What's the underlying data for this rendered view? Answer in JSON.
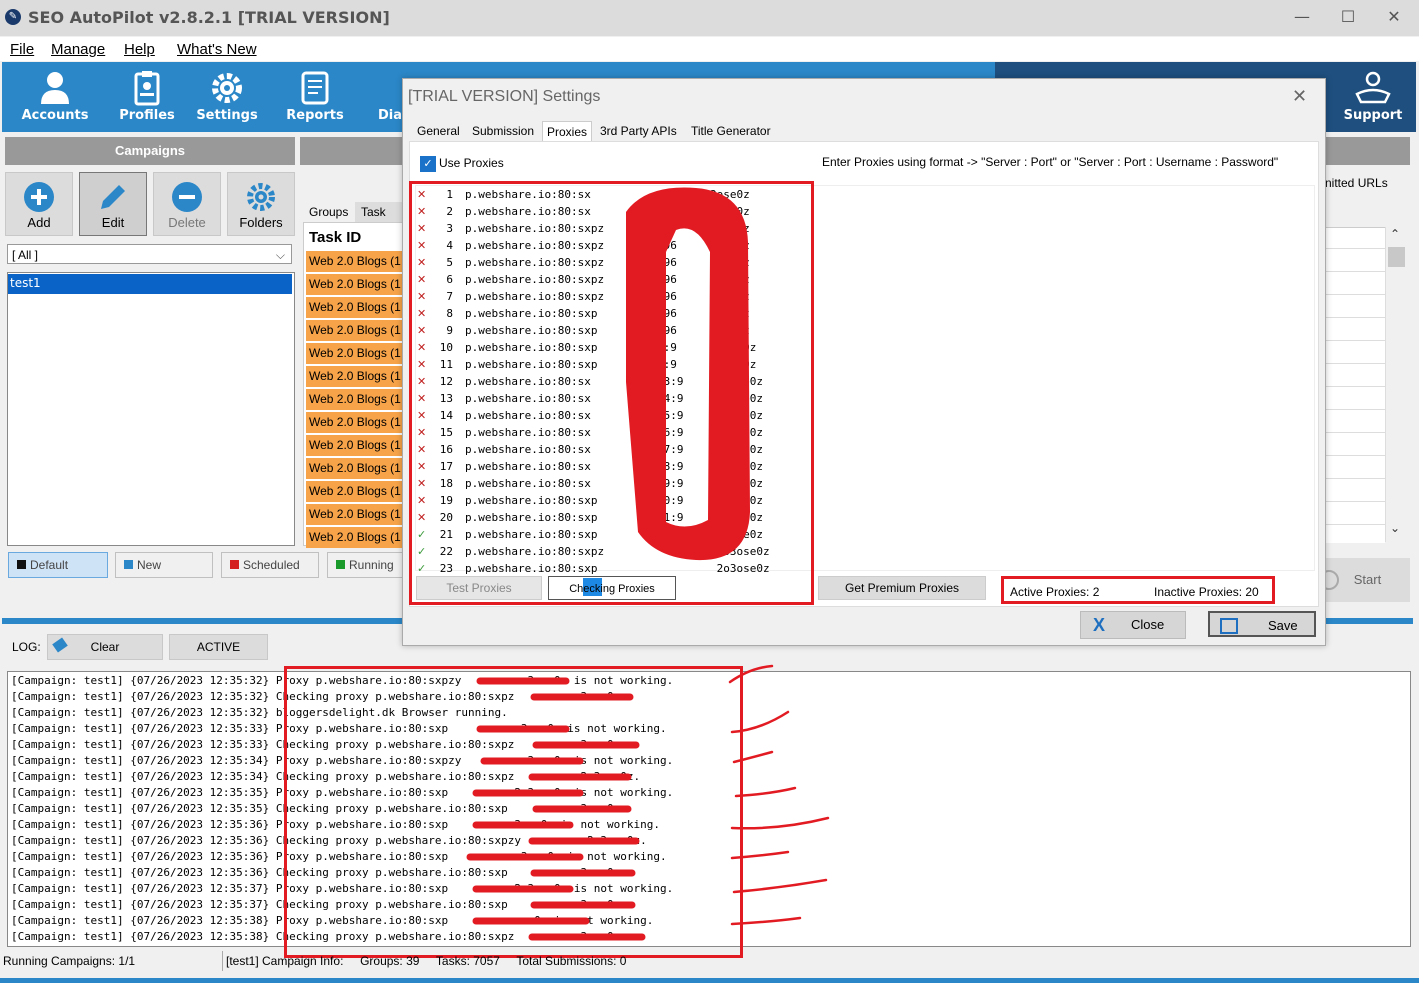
{
  "window": {
    "title": "SEO AutoPilot v2.8.2.1  [TRIAL VERSION]",
    "minimize": "—",
    "maximize": "☐",
    "close": "✕"
  },
  "menu": {
    "file": "File",
    "manage": "Manage",
    "help": "Help",
    "whats_new": "What's New"
  },
  "toolbar": {
    "accounts": "Accounts",
    "profiles": "Profiles",
    "settings": "Settings",
    "reports": "Reports",
    "diag": "Diag",
    "support": "Support"
  },
  "campaigns": {
    "header": "Campaigns",
    "add": "Add",
    "edit": "Edit",
    "delete": "Delete",
    "folders": "Folders",
    "filter": "[ All ]",
    "items": [
      "test1"
    ]
  },
  "status_tabs": {
    "default": "Default",
    "new": "New",
    "scheduled": "Scheduled",
    "running": "Running"
  },
  "groups": {
    "tab_groups": "Groups",
    "tab_task": "Task De",
    "task_id_header": "Task ID",
    "rows": [
      "Web 2.0 Blogs (1",
      "Web 2.0 Blogs (1",
      "Web 2.0 Blogs (1",
      "Web 2.0 Blogs (1",
      "Web 2.0 Blogs (1",
      "Web 2.0 Blogs (1",
      "Web 2.0 Blogs (1",
      "Web 2.0 Blogs (1",
      "Web 2.0 Blogs (1",
      "Web 2.0 Blogs (1",
      "Web 2.0 Blogs (1",
      "Web 2.0 Blogs (1",
      "Web 2.0 Blogs (1"
    ]
  },
  "right_panel": {
    "urls_label": "nitted URLs",
    "start": "Start"
  },
  "log": {
    "label": "LOG:",
    "clear": "Clear",
    "active": "ACTIVE",
    "lines": [
      "[Campaign: test1] {07/26/2023 12:35:32} Proxy p.webshare.io:80:sxpzy          3ose0z is not working.",
      "[Campaign: test1] {07/26/2023 12:35:32} Checking proxy p.webshare.io:80:sxpz          3ose0z.",
      "[Campaign: test1] {07/26/2023 12:35:32} bloggersdelight.dk Browser running.",
      "[Campaign: test1] {07/26/2023 12:35:33} Proxy p.webshare.io:80:sxp          o3ose0z is not working.",
      "[Campaign: test1] {07/26/2023 12:35:33} Checking proxy p.webshare.io:80:sxpz          3ose0z.",
      "[Campaign: test1] {07/26/2023 12:35:34} Proxy p.webshare.io:80:sxpzy          3ose0z is not working.",
      "[Campaign: test1] {07/26/2023 12:35:34} Checking proxy p.webshare.io:80:sxpz          2o3ose0z.",
      "[Campaign: test1] {07/26/2023 12:35:35} Proxy p.webshare.io:80:sxp          2o3ose0z is not working.",
      "[Campaign: test1] {07/26/2023 12:35:35} Checking proxy p.webshare.io:80:sxp          o3ose0z.",
      "[Campaign: test1] {07/26/2023 12:35:36} Proxy p.webshare.io:80:sxp          3ose0z is not working.",
      "[Campaign: test1] {07/26/2023 12:35:36} Checking proxy p.webshare.io:80:sxpzy          2o3ose0z.",
      "[Campaign: test1] {07/26/2023 12:35:36} Proxy p.webshare.io:80:sxp          o3ose0z is not working.",
      "[Campaign: test1] {07/26/2023 12:35:36} Checking proxy p.webshare.io:80:sxp          o3ose0z.",
      "[Campaign: test1] {07/26/2023 12:35:37} Proxy p.webshare.io:80:sxp          2o3ose0z is not working.",
      "[Campaign: test1] {07/26/2023 12:35:37} Checking proxy p.webshare.io:80:sxp          o3ose0z.",
      "[Campaign: test1] {07/26/2023 12:35:38} Proxy p.webshare.io:80:sxp          ose0z is not working.",
      "[Campaign: test1] {07/26/2023 12:35:38} Checking proxy p.webshare.io:80:sxpz          3ose0z."
    ]
  },
  "status_bar": {
    "running": "Running Campaigns: 1/1",
    "info": "[test1] Campaign Info:     Groups: 39     Tasks: 7057     Total Submissions: 0"
  },
  "settings_dialog": {
    "title": "[TRIAL VERSION] Settings",
    "close_x": "✕",
    "tabs": [
      "General",
      "Submission",
      "Proxies",
      "3rd Party APIs",
      "Title Generator"
    ],
    "use_proxies": "Use Proxies",
    "format_hint": "Enter Proxies using format -> \"Server : Port\"  or  \"Server : Port : Username : Password\"",
    "proxies": [
      {
        "n": "1",
        "text": "p.webshare.io:80:sx                  3ose0z",
        "ok": false
      },
      {
        "n": "2",
        "text": "p.webshare.io:80:sx                  3ose0z",
        "ok": false
      },
      {
        "n": "3",
        "text": "p.webshare.io:80:sxpz                3ose0z",
        "ok": false
      },
      {
        "n": "4",
        "text": "p.webshare.io:80:sxpz        :96     3ose0z",
        "ok": false
      },
      {
        "n": "5",
        "text": "p.webshare.io:80:sxpz        :96     3ose0z",
        "ok": false
      },
      {
        "n": "6",
        "text": "p.webshare.io:80:sxpz        :96     3ose0z",
        "ok": false
      },
      {
        "n": "7",
        "text": "p.webshare.io:80:sxpz        :96     3ose0z",
        "ok": false
      },
      {
        "n": "8",
        "text": "p.webshare.io:80:sxp         :96     3ose0z",
        "ok": false
      },
      {
        "n": "9",
        "text": "p.webshare.io:80:sxp        9:96     3ose0z",
        "ok": false
      },
      {
        "n": "10",
        "text": "p.webshare.io:80:sxp        10:9     o3ose0z",
        "ok": false
      },
      {
        "n": "11",
        "text": "p.webshare.io:80:sxp        12:9     o3ose0z",
        "ok": false
      },
      {
        "n": "12",
        "text": "p.webshare.io:80:sx         -13:9     o3ose0z",
        "ok": false
      },
      {
        "n": "13",
        "text": "p.webshare.io:80:sx         -14:9     o3ose0z",
        "ok": false
      },
      {
        "n": "14",
        "text": "p.webshare.io:80:sx         -15:9     o3ose0z",
        "ok": false
      },
      {
        "n": "15",
        "text": "p.webshare.io:80:sx         -16:9     o3ose0z",
        "ok": false
      },
      {
        "n": "16",
        "text": "p.webshare.io:80:sx         -17:9     o3ose0z",
        "ok": false
      },
      {
        "n": "17",
        "text": "p.webshare.io:80:sx         -18:9     o3ose0z",
        "ok": false
      },
      {
        "n": "18",
        "text": "p.webshare.io:80:sx         -19:9     o3ose0z",
        "ok": false
      },
      {
        "n": "19",
        "text": "p.webshare.io:80:sxp        -20:9     o3ose0z",
        "ok": false
      },
      {
        "n": "20",
        "text": "p.webshare.io:80:sxp        -21:9     o3ose0z",
        "ok": false
      },
      {
        "n": "21",
        "text": "p.webshare.io:80:sxp                  o3ose0z",
        "ok": true
      },
      {
        "n": "22",
        "text": "p.webshare.io:80:sxpz                 2o3ose0z",
        "ok": true
      },
      {
        "n": "23",
        "text": "p.webshare.io:80:sxp                  2o3ose0z",
        "ok": true
      }
    ],
    "test_proxies": "Test Proxies",
    "checking_proxies": "Checking Proxies",
    "checking_progress": 0.15,
    "get_premium": "Get Premium Proxies",
    "active_proxies": "Active Proxies: 2",
    "inactive_proxies": "Inactive Proxies: 20",
    "close": "Close",
    "save": "Save"
  },
  "colors": {
    "accent": "#2b87c8",
    "annotation_red": "#e21b23",
    "task_row": "#f6a349",
    "selected": "#0a64c8"
  }
}
